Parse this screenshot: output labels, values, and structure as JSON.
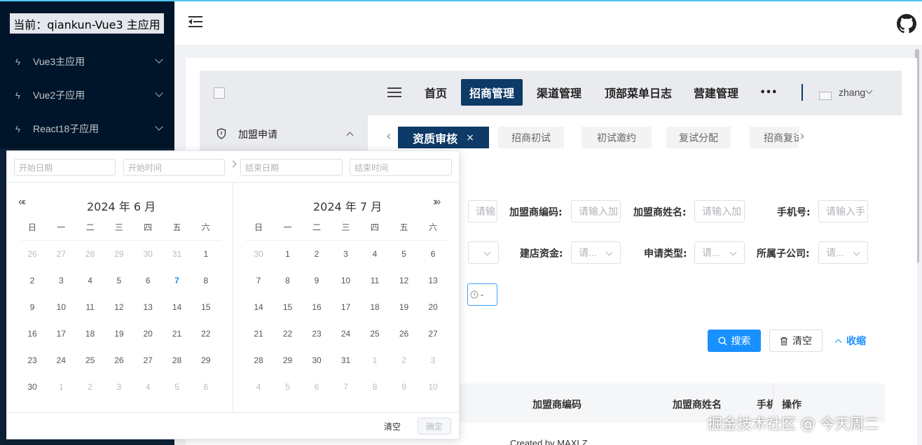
{
  "host": {
    "current_app_label": "当前：qiankun-Vue3 主应用",
    "menu": [
      {
        "label": "Vue3主应用"
      },
      {
        "label": "Vue2子应用"
      },
      {
        "label": "React18子应用"
      }
    ],
    "github_icon": "github-icon",
    "fold_icon": "menu-fold-icon"
  },
  "inner": {
    "top_nav": [
      {
        "label": "首页",
        "active": false
      },
      {
        "label": "招商管理",
        "active": true
      },
      {
        "label": "渠道管理",
        "active": false
      },
      {
        "label": "顶部菜单日志",
        "active": false
      },
      {
        "label": "营建管理",
        "active": false
      },
      {
        "label": "•••",
        "active": false
      }
    ],
    "user_name": "zhang",
    "sidebar_item": "加盟申请",
    "tags": [
      {
        "label": "资质审核",
        "active": true,
        "close": "×"
      },
      {
        "label": "招商初试",
        "active": false
      },
      {
        "label": "初试邀约",
        "active": false
      },
      {
        "label": "复试分配",
        "active": false
      },
      {
        "label": "招商复试",
        "active": false
      }
    ],
    "form": {
      "row1": {
        "first_placeholder": "请输",
        "franchisee_code_label": "加盟商编码:",
        "franchisee_code_placeholder": "请输入加",
        "franchisee_name_label": "加盟商姓名:",
        "franchisee_name_placeholder": "请输入加",
        "phone_label": "手机号:",
        "phone_placeholder": "请输入手"
      },
      "row2": {
        "capital_label": "建店资金:",
        "capital_placeholder": "请...",
        "apply_type_label": "申请类型:",
        "apply_type_placeholder": "请...",
        "subsidiary_label": "所属子公司:",
        "subsidiary_placeholder": "请..."
      },
      "time_range_text": "-",
      "search_button": "搜索",
      "clear_button": "清空",
      "collapse_button": "收缩"
    },
    "table_headers": [
      "加盟商编码",
      "加盟商姓名",
      "手机",
      "操作"
    ],
    "footer": "Created by MAXLZ",
    "watermark": "掘金技术社区 @ 今天周二"
  },
  "picker": {
    "start_date_placeholder": "开始日期",
    "start_time_placeholder": "开始时间",
    "end_date_placeholder": "结束日期",
    "end_time_placeholder": "结束时间",
    "weekdays": [
      "日",
      "一",
      "二",
      "三",
      "四",
      "五",
      "六"
    ],
    "left": {
      "title": "2024 年 6 月",
      "nav_prev": "«‹",
      "weeks": [
        [
          {
            "d": "26",
            "m": true
          },
          {
            "d": "27",
            "m": true
          },
          {
            "d": "28",
            "m": true
          },
          {
            "d": "29",
            "m": true
          },
          {
            "d": "30",
            "m": true
          },
          {
            "d": "31",
            "m": true
          },
          {
            "d": "1"
          }
        ],
        [
          {
            "d": "2"
          },
          {
            "d": "3"
          },
          {
            "d": "4"
          },
          {
            "d": "5"
          },
          {
            "d": "6"
          },
          {
            "d": "7",
            "today": true
          },
          {
            "d": "8"
          }
        ],
        [
          {
            "d": "9"
          },
          {
            "d": "10"
          },
          {
            "d": "11"
          },
          {
            "d": "12"
          },
          {
            "d": "13"
          },
          {
            "d": "14"
          },
          {
            "d": "15"
          }
        ],
        [
          {
            "d": "16"
          },
          {
            "d": "17"
          },
          {
            "d": "18"
          },
          {
            "d": "19"
          },
          {
            "d": "20"
          },
          {
            "d": "21"
          },
          {
            "d": "22"
          }
        ],
        [
          {
            "d": "23"
          },
          {
            "d": "24"
          },
          {
            "d": "25"
          },
          {
            "d": "26"
          },
          {
            "d": "27"
          },
          {
            "d": "28"
          },
          {
            "d": "29"
          }
        ],
        [
          {
            "d": "30"
          },
          {
            "d": "1",
            "m": true
          },
          {
            "d": "2",
            "m": true
          },
          {
            "d": "3",
            "m": true
          },
          {
            "d": "4",
            "m": true
          },
          {
            "d": "5",
            "m": true
          },
          {
            "d": "6",
            "m": true
          }
        ]
      ]
    },
    "right": {
      "title": "2024 年 7 月",
      "nav_next": "›»",
      "weeks": [
        [
          {
            "d": "30",
            "m": true
          },
          {
            "d": "1"
          },
          {
            "d": "2"
          },
          {
            "d": "3"
          },
          {
            "d": "4"
          },
          {
            "d": "5"
          },
          {
            "d": "6"
          }
        ],
        [
          {
            "d": "7"
          },
          {
            "d": "8"
          },
          {
            "d": "9"
          },
          {
            "d": "10"
          },
          {
            "d": "11"
          },
          {
            "d": "12"
          },
          {
            "d": "13"
          }
        ],
        [
          {
            "d": "14"
          },
          {
            "d": "15"
          },
          {
            "d": "16"
          },
          {
            "d": "17"
          },
          {
            "d": "18"
          },
          {
            "d": "19"
          },
          {
            "d": "20"
          }
        ],
        [
          {
            "d": "21"
          },
          {
            "d": "22"
          },
          {
            "d": "23"
          },
          {
            "d": "24"
          },
          {
            "d": "25"
          },
          {
            "d": "26"
          },
          {
            "d": "27"
          }
        ],
        [
          {
            "d": "28"
          },
          {
            "d": "29"
          },
          {
            "d": "30"
          },
          {
            "d": "31"
          },
          {
            "d": "1",
            "m": true
          },
          {
            "d": "2",
            "m": true
          },
          {
            "d": "3",
            "m": true
          }
        ],
        [
          {
            "d": "4",
            "m": true
          },
          {
            "d": "5",
            "m": true
          },
          {
            "d": "6",
            "m": true
          },
          {
            "d": "7",
            "m": true
          },
          {
            "d": "8",
            "m": true
          },
          {
            "d": "9",
            "m": true
          },
          {
            "d": "10",
            "m": true
          }
        ]
      ]
    },
    "clear_label": "清空",
    "confirm_label": "确定"
  },
  "colors": {
    "host_sidebar": "#001529",
    "inner_active": "#0d3a66",
    "primary": "#1890ff",
    "today": "#1890ff"
  }
}
